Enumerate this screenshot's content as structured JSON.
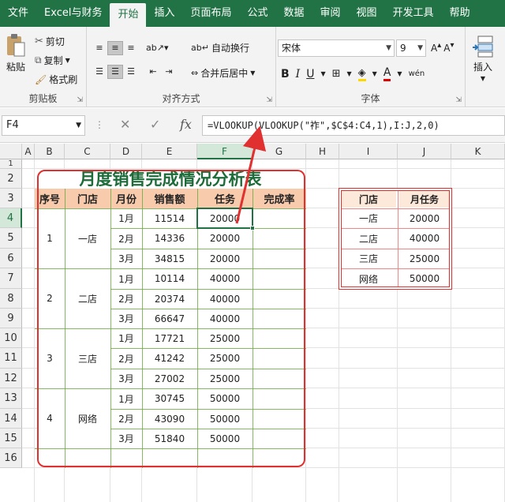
{
  "ribbon_tabs": [
    "文件",
    "Excel与财务",
    "开始",
    "插入",
    "页面布局",
    "公式",
    "数据",
    "审阅",
    "视图",
    "开发工具",
    "帮助"
  ],
  "active_tab": "开始",
  "clipboard": {
    "paste": "粘贴",
    "cut": "剪切",
    "copy": "复制",
    "format_painter": "格式刷",
    "label": "剪贴板"
  },
  "alignment": {
    "wrap": "自动换行",
    "merge": "合并后居中",
    "label": "对齐方式"
  },
  "font": {
    "name": "宋体",
    "size": "9",
    "label": "字体",
    "bold": "B",
    "italic": "I",
    "underline": "U"
  },
  "insert": {
    "label": "插入"
  },
  "name_box": "F4",
  "formula": "=VLOOKUP(VLOOKUP(\"祚\",$C$4:C4,1),I:J,2,0)",
  "columns": [
    "A",
    "B",
    "C",
    "D",
    "E",
    "F",
    "G",
    "H",
    "I",
    "J",
    "K"
  ],
  "selected_column": "F",
  "rows": [
    "1",
    "2",
    "3",
    "4",
    "5",
    "6",
    "7",
    "8",
    "9",
    "10",
    "11",
    "12",
    "13",
    "14",
    "15",
    "16"
  ],
  "selected_row": "4",
  "main_table": {
    "title": "月度销售完成情况分析表",
    "headers": [
      "序号",
      "门店",
      "月份",
      "销售额",
      "任务",
      "完成率"
    ],
    "groups": [
      {
        "no": "1",
        "store": "一店",
        "rows": [
          [
            "1月",
            "11514",
            "20000"
          ],
          [
            "2月",
            "14336",
            "20000"
          ],
          [
            "3月",
            "34815",
            "20000"
          ]
        ]
      },
      {
        "no": "2",
        "store": "二店",
        "rows": [
          [
            "1月",
            "10114",
            "40000"
          ],
          [
            "2月",
            "20374",
            "40000"
          ],
          [
            "3月",
            "66647",
            "40000"
          ]
        ]
      },
      {
        "no": "3",
        "store": "三店",
        "rows": [
          [
            "1月",
            "17721",
            "25000"
          ],
          [
            "2月",
            "41242",
            "25000"
          ],
          [
            "3月",
            "27002",
            "25000"
          ]
        ]
      },
      {
        "no": "4",
        "store": "网络",
        "rows": [
          [
            "1月",
            "30745",
            "50000"
          ],
          [
            "2月",
            "43090",
            "50000"
          ],
          [
            "3月",
            "51840",
            "50000"
          ]
        ]
      }
    ]
  },
  "lookup_table": {
    "headers": [
      "门店",
      "月任务"
    ],
    "rows": [
      [
        "一店",
        "20000"
      ],
      [
        "二店",
        "40000"
      ],
      [
        "三店",
        "25000"
      ],
      [
        "网络",
        "50000"
      ]
    ]
  },
  "colors": {
    "excel_green": "#217346",
    "header_fill": "#f8cbad",
    "table_border": "#70ad47",
    "annotation_red": "#e03030"
  }
}
